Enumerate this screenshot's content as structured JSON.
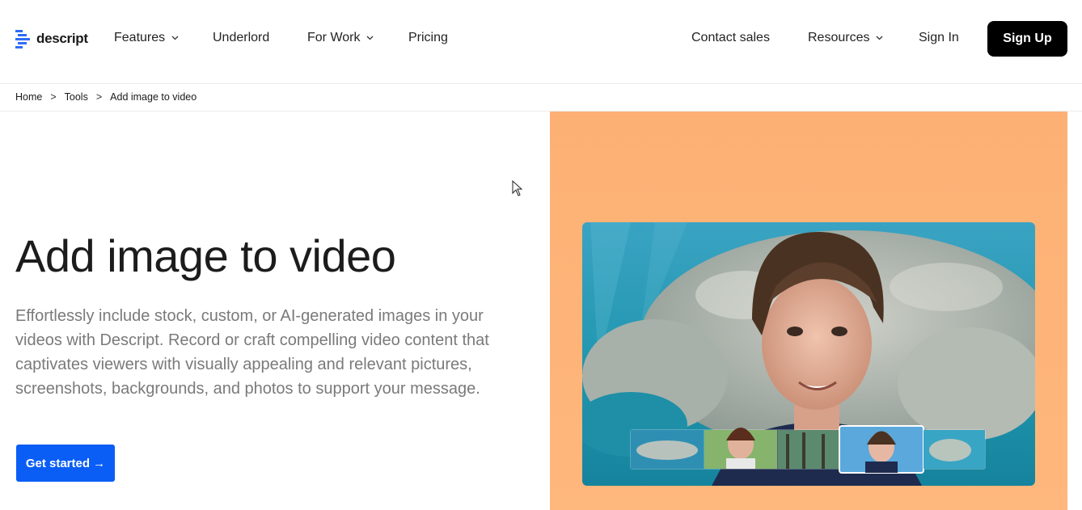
{
  "brand": {
    "name": "descript",
    "accent": "#0a5ef5",
    "logo_icon": "descript-logo-icon"
  },
  "nav": {
    "left": [
      {
        "label": "Features",
        "has_dropdown": true
      },
      {
        "label": "Underlord",
        "has_dropdown": false
      },
      {
        "label": "For Work",
        "has_dropdown": true
      },
      {
        "label": "Pricing",
        "has_dropdown": false
      }
    ],
    "right": [
      {
        "label": "Contact sales",
        "has_dropdown": false
      },
      {
        "label": "Resources",
        "has_dropdown": true
      },
      {
        "label": "Sign In",
        "has_dropdown": false
      }
    ],
    "signup_label": "Sign Up"
  },
  "breadcrumb": {
    "items": [
      "Home",
      "Tools",
      "Add image to video"
    ],
    "separator": ">"
  },
  "hero": {
    "title": "Add image to video",
    "description": "Effortlessly include stock, custom, or AI-generated images in your videos with Descript. Record or craft compelling video content that captivates viewers with visually appealing and relevant pictures, screenshots, backgrounds, and photos to support your message.",
    "cta_label": "Get started →"
  },
  "media": {
    "panel_color": "#fdb074",
    "video_subject": "presenter over manatee underwater background",
    "thumbnails": [
      "manatee",
      "presenter-green-screen",
      "forest",
      "presenter-selected",
      "manatee-2"
    ],
    "selected_thumbnail": 3
  }
}
